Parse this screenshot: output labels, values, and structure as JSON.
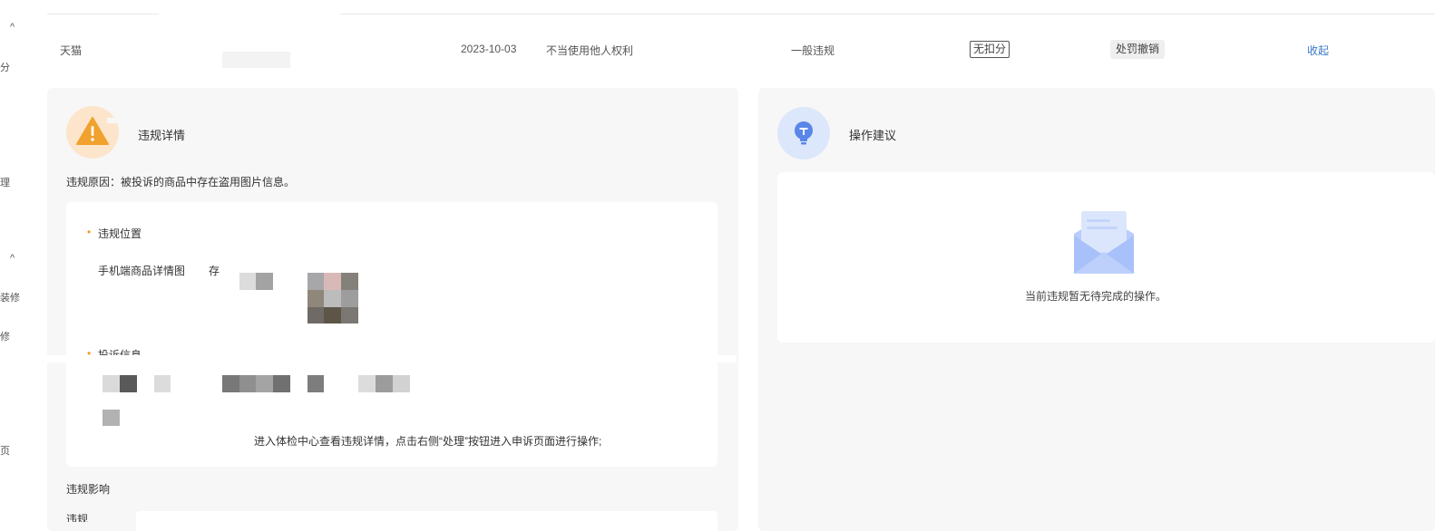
{
  "sidebar": {
    "carets": [
      "^",
      "^"
    ],
    "items": [
      "分",
      "理",
      "装修",
      "修",
      "页"
    ]
  },
  "record": {
    "platform": "天猫",
    "date": "2023-10-03",
    "violation_type": "不当使用他人权利",
    "level": "一般违规",
    "deduction_tag": "无扣分",
    "penalty_tag": "处罚撤销",
    "collapse_link": "收起"
  },
  "details_panel": {
    "title": "违规详情",
    "reason": "违规原因：被投诉的商品中存在盗用图片信息。",
    "location_label": "违规位置",
    "location_value": "手机端商品详情图",
    "location_extra": "存",
    "complaint_label": "投诉信息",
    "instruction": "进入体检中心查看违规详情，点击右侧“处理”按钮进入申诉页面进行操作;",
    "impact_label": "违规影响",
    "bottom_label": "违规"
  },
  "advice_panel": {
    "title": "操作建议",
    "empty_text": "当前违规暂无待完成的操作。"
  },
  "colors": {
    "link": "#3a78c8",
    "warning": "#f0a12e",
    "bulb": "#5a86e8",
    "panel_bg": "#f7f7f7"
  },
  "icons": {
    "warning": "warning-triangle-icon",
    "advice": "lightbulb-icon",
    "empty": "empty-envelope-icon"
  }
}
